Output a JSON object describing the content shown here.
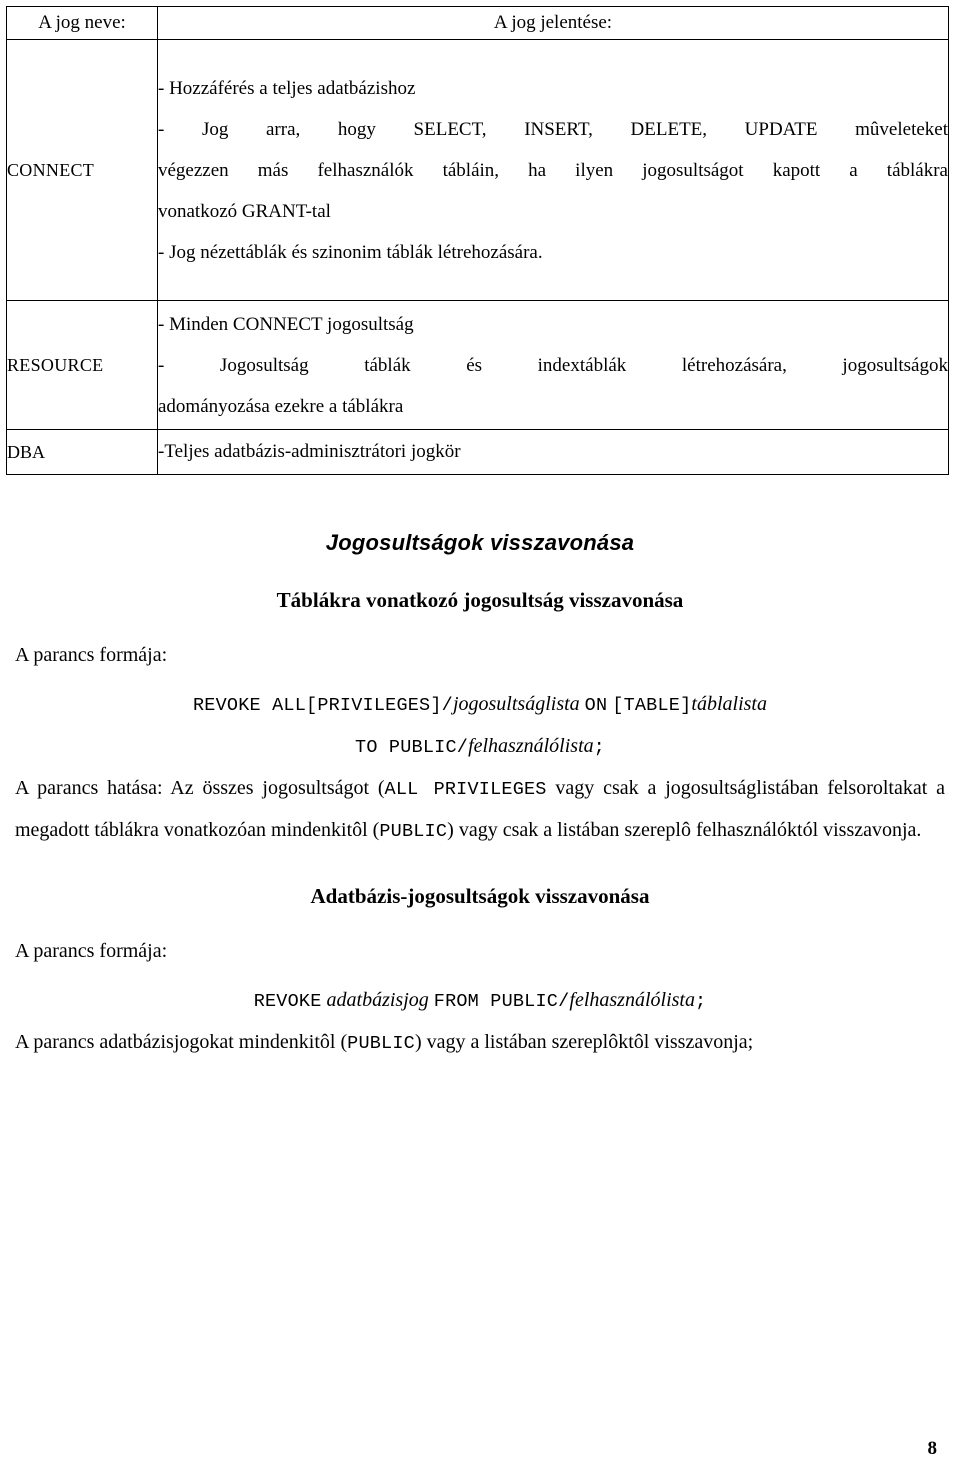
{
  "table": {
    "headers": {
      "name": "A jog neve:",
      "meaning": "A jog jelentése:"
    },
    "rows": [
      {
        "name": "CONNECT",
        "lines": [
          "- Hozzáférés a teljes adatbázishoz",
          "- Jog arra, hogy SELECT, INSERT, DELETE, UPDATE mûveleteket",
          "végezzen más felhasználók tábláin, ha ilyen jogosultságot kapott a táblákra",
          "vonatkozó GRANT-tal",
          "- Jog nézettáblák és szinonim táblák létrehozására."
        ]
      },
      {
        "name": "RESOURCE",
        "lines": [
          "- Minden CONNECT jogosultság",
          "- Jogosultság táblák és indextáblák létrehozására, jogosultságok",
          "adományozása ezekre a táblákra"
        ]
      },
      {
        "name": "DBA",
        "lines": [
          "-Teljes adatbázis-adminisztrátori jogkör"
        ]
      }
    ]
  },
  "sections": {
    "main_heading": "Jogosultságok visszavonása",
    "table_rights": {
      "heading": "Táblákra vonatkozó jogosultság visszavonása",
      "form_label": "A parancs formája:",
      "syntax_line1": {
        "mono1": "REVOKE ALL",
        "mono2": "[PRIVILEGES]",
        "slash": "/",
        "ital1": "jogosultságlista",
        "mono3": "ON",
        "mono4": "[TABLE]",
        "ital2": "táblalista"
      },
      "syntax_line2": {
        "mono1": "TO PUBLIC",
        "slash": "/",
        "ital1": "felhasználólista",
        "semicolon": ";"
      },
      "effect": {
        "part1": "A parancs hatása: Az összes jogosultságot (",
        "mono1": "ALL PRIVILEGES",
        "part2": " vagy csak a jogosultságlistában felsoroltakat a megadott táblákra vonatkozóan mindenkitôl (",
        "mono2": "PUBLIC",
        "part3": ") vagy csak a listában szereplô felhasználóktól visszavonja."
      }
    },
    "db_rights": {
      "heading": "Adatbázis-jogosultságok visszavonása",
      "form_label": "A parancs formája:",
      "syntax_line1": {
        "mono1": "REVOKE",
        "ital1": "adatbázisjog",
        "mono2": "FROM PUBLIC",
        "slash": "/",
        "ital2": "felhasználólista",
        "semicolon": ";"
      },
      "effect": {
        "part1": "A parancs adatbázisjogokat mindenkitôl (",
        "mono1": "PUBLIC",
        "part2": ") vagy a listában szereplôktôl visszavonja;"
      }
    }
  },
  "footer": {
    "page_number": "8"
  }
}
